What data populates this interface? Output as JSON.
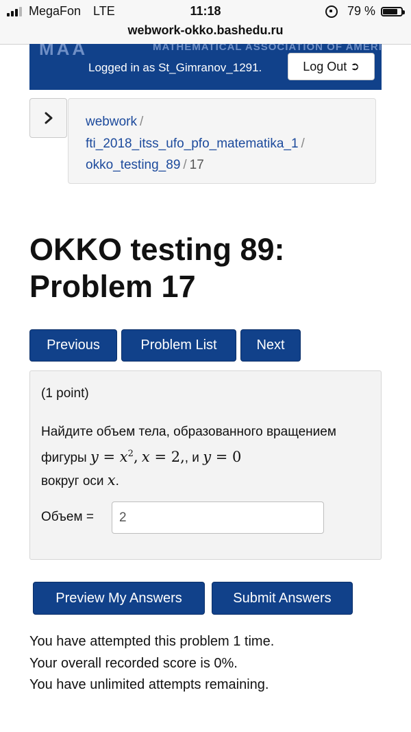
{
  "status_bar": {
    "carrier": "MegaFon",
    "network": "LTE",
    "time": "11:18",
    "battery": "79 %",
    "battery_level": 0.79
  },
  "browser": {
    "url": "webwork-okko.bashedu.ru"
  },
  "header": {
    "org_name": "MATHEMATICAL ASSOCIATION OF AMERICA",
    "logo_text": "MAA",
    "logged_in_text": "Logged in as St_Gimranov_1291.",
    "logout_label": "Log Out",
    "brand_color": "#11418a"
  },
  "breadcrumb": {
    "items": [
      {
        "label": "webwork"
      },
      {
        "label": "fti_2018_itss_ufo_pfo_matematika_1"
      },
      {
        "label": "okko_testing_89"
      }
    ],
    "current": "17",
    "separator": "/"
  },
  "page": {
    "title_line1": "OKKO testing 89:",
    "title_line2": "Problem 17"
  },
  "nav": {
    "previous_label": "Previous",
    "problem_list_label": "Problem List",
    "next_label": "Next"
  },
  "problem": {
    "points": "(1 point)",
    "text_intro": "Найдите объем тела, образованного вращением фигуры",
    "text_and": ", и",
    "text_around": "вокруг оси",
    "answer_label": "Объем =",
    "answer_value": "2"
  },
  "actions": {
    "preview_label": "Preview My Answers",
    "submit_label": "Submit Answers"
  },
  "status": {
    "attempts": "You have attempted this problem 1 time.",
    "score": "Your overall recorded score is 0%.",
    "remaining": "You have unlimited attempts remaining."
  }
}
